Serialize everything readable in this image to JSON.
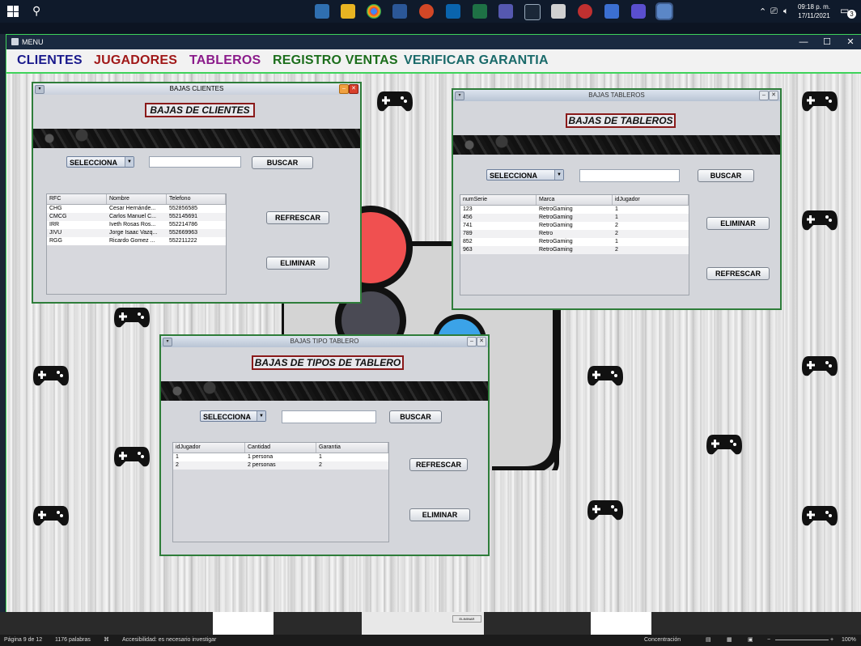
{
  "taskbar": {
    "clock_time": "09:18 p. m.",
    "clock_date": "17/11/2021",
    "notification_count": "3"
  },
  "window": {
    "title": "MENU",
    "minimize": "—",
    "maximize": "☐",
    "close": "✕"
  },
  "menu": {
    "items": [
      {
        "label": "CLIENTES",
        "color": "#1a1a8c"
      },
      {
        "label": "JUGADORES",
        "color": "#a01818"
      },
      {
        "label": "TABLEROS",
        "color": "#8a1a8a"
      },
      {
        "label": "REGISTRO VENTAS",
        "color": "#1c6e1c"
      },
      {
        "label": "VERIFICAR GARANTIA",
        "color": "#1a6a6a"
      }
    ]
  },
  "bajas_clientes": {
    "window_title": "BAJAS CLIENTES",
    "heading": "BAJAS DE CLIENTES",
    "select_value": "SELECCIONA",
    "search_value": "",
    "buscar": "BUSCAR",
    "refrescar": "REFRESCAR",
    "eliminar": "ELIMINAR",
    "columns": [
      "RFC",
      "Nombre",
      "Telefono"
    ],
    "rows": [
      [
        "CHG",
        "Cesar Hernánde...",
        "552856585"
      ],
      [
        "CMCG",
        "Carlos Manuel C...",
        "552145691"
      ],
      [
        "IRR",
        "Iveth Rosas Ros...",
        "552214786"
      ],
      [
        "JIVU",
        "Jorge Isaac Vazq...",
        "552669963"
      ],
      [
        "RGG",
        "Ricardo Gomez ...",
        "552211222"
      ]
    ]
  },
  "bajas_tableros": {
    "window_title": "BAJAS TABLEROS",
    "heading": "BAJAS DE TABLEROS",
    "select_value": "SELECCIONA",
    "search_value": "",
    "buscar": "BUSCAR",
    "eliminar": "ELIMINAR",
    "refrescar": "REFRESCAR",
    "columns": [
      "numSerie",
      "Marca",
      "idJugador"
    ],
    "rows": [
      [
        "123",
        "RetroGaming",
        "1"
      ],
      [
        "456",
        "RetroGaming",
        "1"
      ],
      [
        "741",
        "RetroGaming",
        "2"
      ],
      [
        "789",
        "Retro",
        "2"
      ],
      [
        "852",
        "RetroGaming",
        "1"
      ],
      [
        "963",
        "RetroGaming",
        "2"
      ]
    ]
  },
  "bajas_tipo": {
    "window_title": "BAJAS TIPO TABLERO",
    "heading": "BAJAS DE TIPOS DE TABLERO",
    "select_value": "SELECCIONA",
    "search_value": "",
    "buscar": "BUSCAR",
    "refrescar": "REFRESCAR",
    "eliminar": "ELIMINAR",
    "columns": [
      "idJugador",
      "Cantidad",
      "Garantia"
    ],
    "rows": [
      [
        "1",
        "1 persona",
        "1"
      ],
      [
        "2",
        "2 personas",
        "2"
      ]
    ]
  },
  "word_status": {
    "page": "Página 9 de 12",
    "words": "1176 palabras",
    "accessibility": "Accesibilidad: es necesario investigar",
    "focus": "Concentración",
    "zoom": "100%",
    "thumb_button": "ELIMINAR"
  }
}
